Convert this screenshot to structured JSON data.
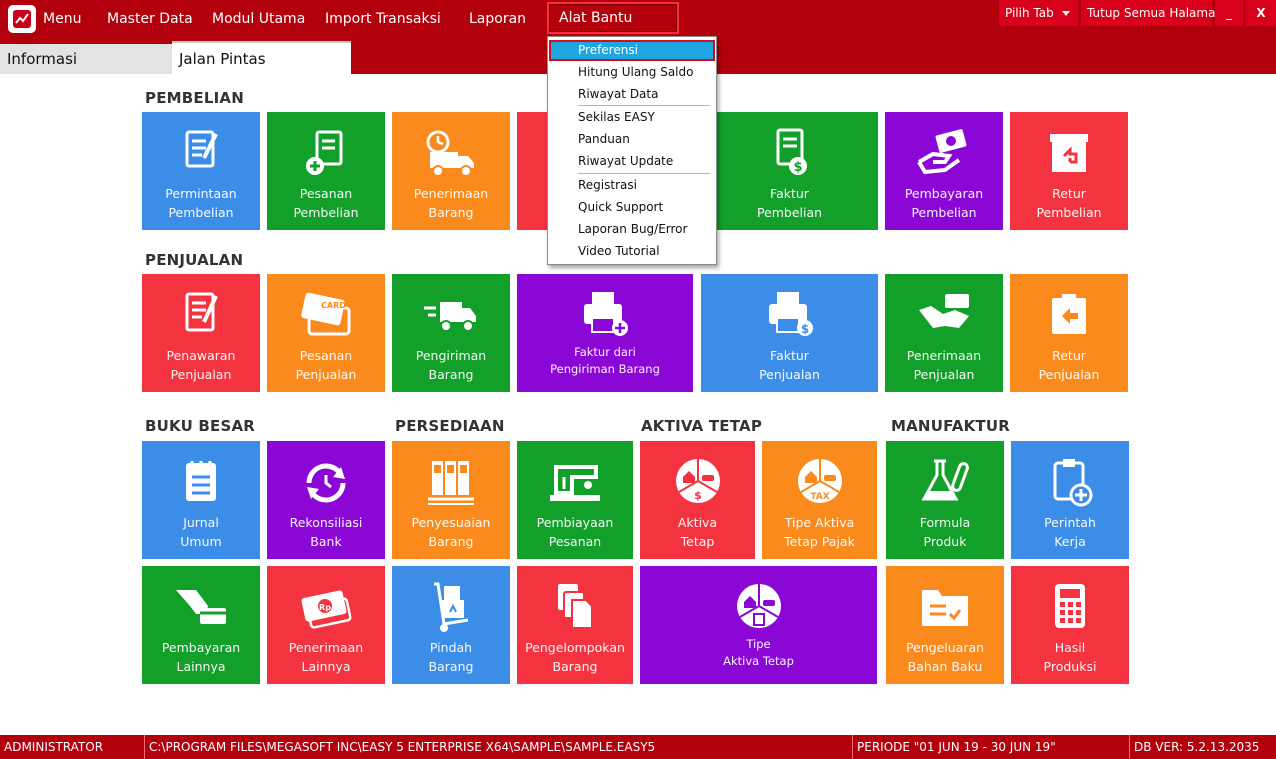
{
  "menubar": {
    "items": [
      "Menu",
      "Master Data",
      "Modul Utama",
      "Import Transaksi",
      "Laporan",
      "Alat Bantu"
    ],
    "right": {
      "pilih_tab": "Pilih Tab",
      "tutup": "Tutup Semua Halaman",
      "minimize": "_",
      "close": "X"
    }
  },
  "tabs": [
    "Informasi",
    "Jalan Pintas"
  ],
  "sections": {
    "pembelian": "PEMBELIAN",
    "penjualan": "PENJUALAN",
    "buku_besar": "BUKU BESAR",
    "persediaan": "PERSEDIAAN",
    "aktiva_tetap": "AKTIVA TETAP",
    "manufaktur": "MANUFAKTUR"
  },
  "tiles": {
    "permintaan_pembelian": "Permintaan\nPembelian",
    "pesanan_pembelian": "Pesanan\nPembelian",
    "penerimaan_barang": "Penerimaan\nBarang",
    "faktur_pembelian": "Faktur\nPembelian",
    "pembayaran_pembelian": "Pembayaran\nPembelian",
    "retur_pembelian": "Retur\nPembelian",
    "penawaran_penjualan": "Penawaran\nPenjualan",
    "pesanan_penjualan": "Pesanan\nPenjualan",
    "pengiriman_barang": "Pengiriman\nBarang",
    "faktur_dari_pengiriman": "Faktur dari\nPengiriman Barang",
    "faktur_penjualan": "Faktur\nPenjualan",
    "penerimaan_penjualan": "Penerimaan\nPenjualan",
    "retur_penjualan": "Retur\nPenjualan",
    "jurnal_umum": "Jurnal\nUmum",
    "rekonsiliasi_bank": "Rekonsiliasi\nBank",
    "penyesuaian_barang": "Penyesuaian\nBarang",
    "pembiayaan_pesanan": "Pembiayaan\nPesanan",
    "aktiva_tetap": "Aktiva\nTetap",
    "tipe_aktiva_tetap_pajak": "Tipe Aktiva\nTetap Pajak",
    "formula_produk": "Formula\nProduk",
    "perintah_kerja": "Perintah\nKerja",
    "pembayaran_lainnya": "Pembayaran\nLainnya",
    "penerimaan_lainnya": "Penerimaan\nLainnya",
    "pindah_barang": "Pindah\nBarang",
    "pengelompokan_barang": "Pengelompokan\nBarang",
    "tipe_aktiva_tetap": "Tipe\nAktiva Tetap",
    "pengeluaran_bahan_baku": "Pengeluaran\nBahan Baku",
    "hasil_produksi": "Hasil\nProduksi"
  },
  "dropdown": {
    "items": [
      "Preferensi",
      "Hitung Ulang Saldo",
      "Riwayat Data",
      "Sekilas EASY",
      "Panduan",
      "Riwayat Update",
      "Registrasi",
      "Quick Support",
      "Laporan Bug/Error",
      "Video Tutorial"
    ]
  },
  "status": {
    "user": "ADMINISTRATOR",
    "path": "C:\\PROGRAM FILES\\MEGASOFT INC\\EASY 5 ENTERPRISE X64\\SAMPLE\\SAMPLE.EASY5",
    "periode": "PERIODE \"01 JUN 19 - 30 JUN 19\"",
    "db": "DB VER: 5.2.13.2035"
  },
  "colors": {
    "brand": "#b3000d",
    "blue": "#3c8de8",
    "green": "#129f2a",
    "orange": "#fb8a1d",
    "red": "#f3333f",
    "purple": "#8a07d6",
    "highlight": "#1fa6e0"
  }
}
